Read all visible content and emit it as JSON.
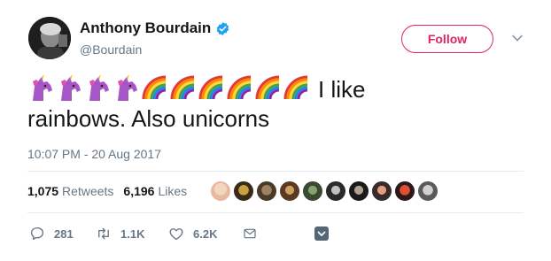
{
  "author": {
    "name": "Anthony Bourdain",
    "handle": "@Bourdain",
    "verified_icon": "verified-badge-icon",
    "verified_color": "#1da1f2"
  },
  "follow_button": {
    "label": "Follow",
    "color": "#e0245e"
  },
  "tweet": {
    "emoji": [
      "unicorn",
      "unicorn",
      "unicorn",
      "unicorn",
      "rainbow",
      "rainbow",
      "rainbow",
      "rainbow",
      "rainbow",
      "rainbow"
    ],
    "text_line1": "I like",
    "text_line2": "rainbows. Also unicorns"
  },
  "timestamp": "10:07 PM - 20 Aug 2017",
  "stats": {
    "retweets_count": "1,075",
    "retweets_label": "Retweets",
    "likes_count": "6,196",
    "likes_label": "Likes"
  },
  "likers_count": 10,
  "actions": {
    "reply_count": "281",
    "retweet_count": "1.1K",
    "like_count": "6.2K"
  }
}
